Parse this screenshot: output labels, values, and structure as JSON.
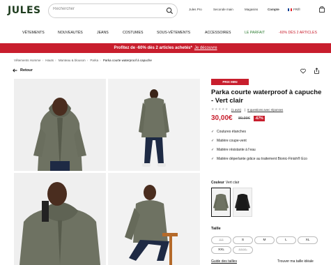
{
  "header": {
    "logo": "JULES",
    "search_placeholder": "Rechercher",
    "links": [
      "Jules Pro",
      "Seconde main",
      "Magasins",
      "Compte",
      "FR/fr"
    ]
  },
  "nav": {
    "items": [
      "VÊTEMENTS",
      "NOUVEAUTÉS",
      "JEANS",
      "COSTUMES",
      "SOUS-VÊTEMENTS",
      "ACCESSOIRES",
      "LE PARFAIT",
      "-60% DÈS 2 ARTICLES"
    ],
    "colors": {
      "le_parfait": "#2e7d32",
      "promo": "#c81e2d"
    }
  },
  "promo": {
    "text": "Profitez de -60% dès 2 articles achetés*",
    "link": "Je découvre",
    "color": "#c81e2d"
  },
  "breadcrumb": [
    "Vêtements Homme",
    "Hauts",
    "Manteau & blouson",
    "Parka",
    "Parka courte waterproof à capuche"
  ],
  "back_label": "Retour",
  "product": {
    "badge": "PRIX MINI",
    "title": "Parka courte waterproof à capuche - Vert clair",
    "reviews": "(1 avis)",
    "questions": "8 questions avec réponses",
    "price": "30,00€",
    "old_price": "89,99€",
    "discount": "-67%",
    "features": [
      "Coutures étanches",
      "Matière coupe-vent",
      "Matière résistante à l'eau",
      "Matière déperlante grâce au traitement Bionic-Finish® Eco"
    ],
    "color_label": "Couleur",
    "color_value": "Vert clair",
    "size_label": "Taille",
    "sizes": [
      {
        "label": "XS",
        "available": false
      },
      {
        "label": "S",
        "available": true
      },
      {
        "label": "M",
        "available": true
      },
      {
        "label": "L",
        "available": true
      },
      {
        "label": "XL",
        "available": true
      },
      {
        "label": "XXL",
        "available": true
      },
      {
        "label": "XXXL",
        "available": false
      }
    ],
    "size_guide": "Guide des tailles",
    "fit_finder": "Trouver ma taille idéale"
  }
}
